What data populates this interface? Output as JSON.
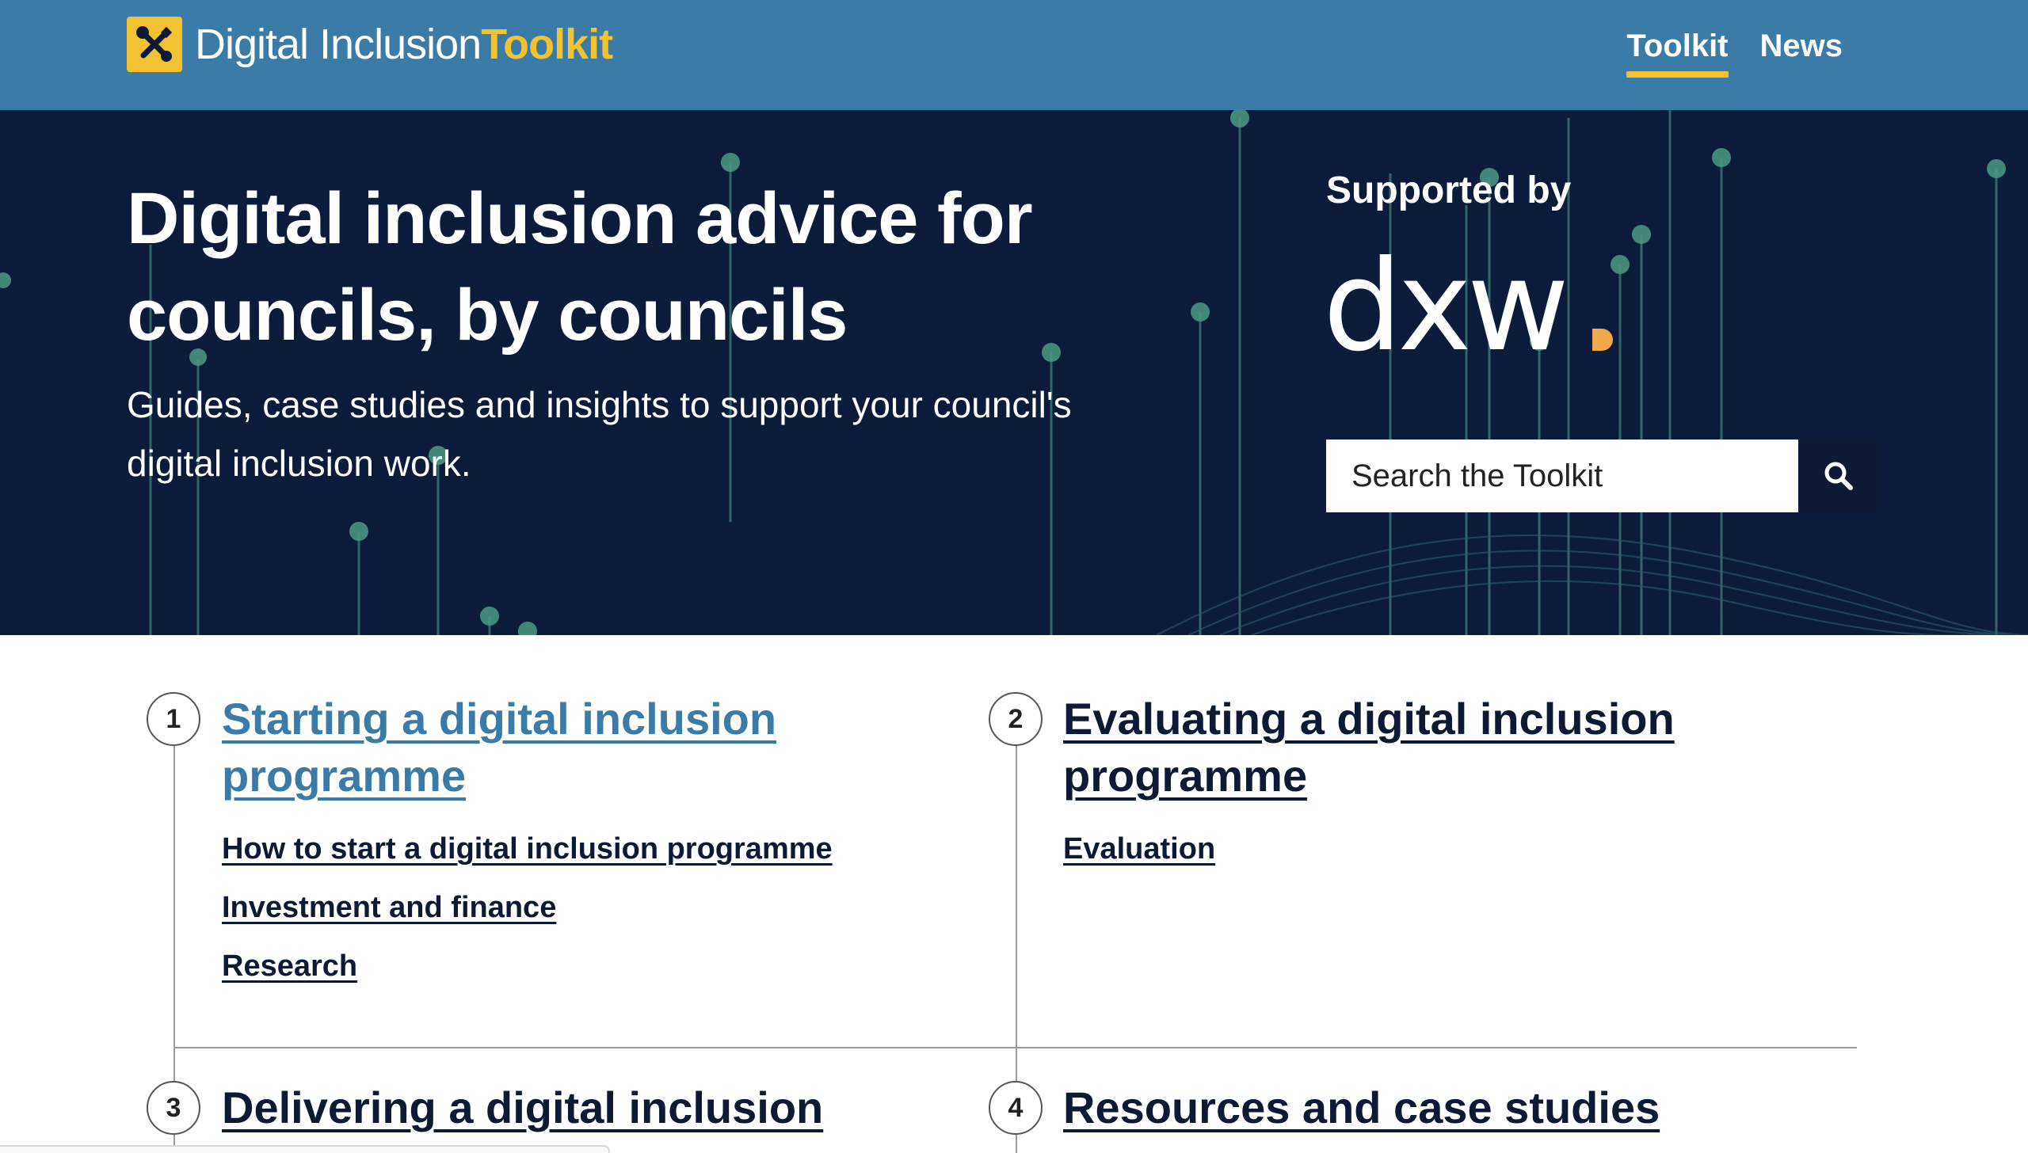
{
  "header": {
    "logo_text_plain": "Digital Inclusion",
    "logo_text_accent": "Toolkit",
    "nav": [
      {
        "label": "Toolkit",
        "active": true
      },
      {
        "label": "News",
        "active": false
      }
    ]
  },
  "hero": {
    "title": "Digital inclusion advice for councils, by councils",
    "subtitle": "Guides, case studies and insights to support your council's digital inclusion work.",
    "supported_by": "Supported by",
    "sponsor_logo_text": "dxw",
    "search": {
      "placeholder": "Search the Toolkit",
      "value": ""
    }
  },
  "sections": [
    {
      "number": "1",
      "title": "Starting a digital inclusion programme",
      "links": [
        "How to start a digital inclusion programme",
        "Investment and finance",
        "Research"
      ]
    },
    {
      "number": "2",
      "title": "Evaluating a digital inclusion programme",
      "links": [
        "Evaluation"
      ]
    },
    {
      "number": "3",
      "title": "Delivering a digital inclusion",
      "links": []
    },
    {
      "number": "4",
      "title": "Resources and case studies",
      "links": []
    }
  ],
  "colors": {
    "header_bg": "#3a7ba8",
    "hero_bg": "#0c1b3a",
    "accent_yellow": "#f2c230",
    "link_dark": "#0e1a33",
    "link_blue": "#3a7ba8",
    "dxw_dot": "#f0a84a"
  }
}
